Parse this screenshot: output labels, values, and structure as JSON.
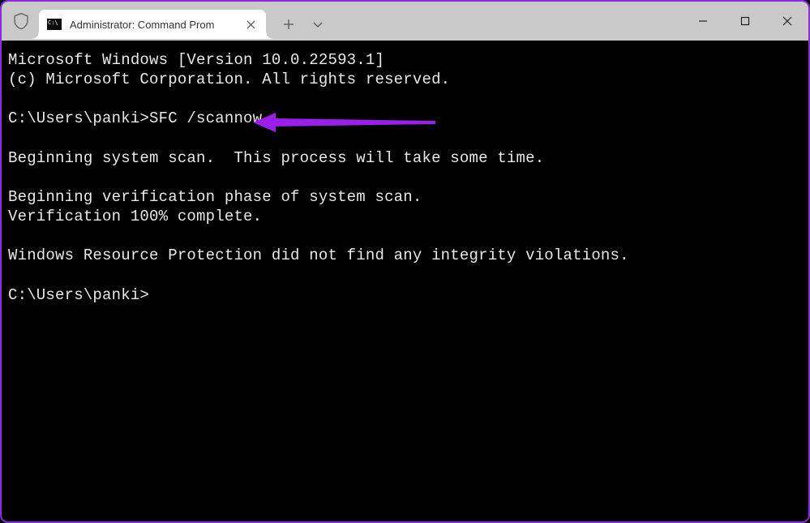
{
  "window": {
    "tab_title": "Administrator: Command Prom",
    "minimize_tooltip": "Minimize",
    "maximize_tooltip": "Maximize",
    "close_tooltip": "Close"
  },
  "terminal": {
    "lines": [
      "Microsoft Windows [Version 10.0.22593.1]",
      "(c) Microsoft Corporation. All rights reserved.",
      "",
      "C:\\Users\\panki>SFC /scannow",
      "",
      "Beginning system scan.  This process will take some time.",
      "",
      "Beginning verification phase of system scan.",
      "Verification 100% complete.",
      "",
      "Windows Resource Protection did not find any integrity violations.",
      "",
      "C:\\Users\\panki>"
    ]
  },
  "annotation": {
    "arrow_color": "#9b1fe8"
  }
}
